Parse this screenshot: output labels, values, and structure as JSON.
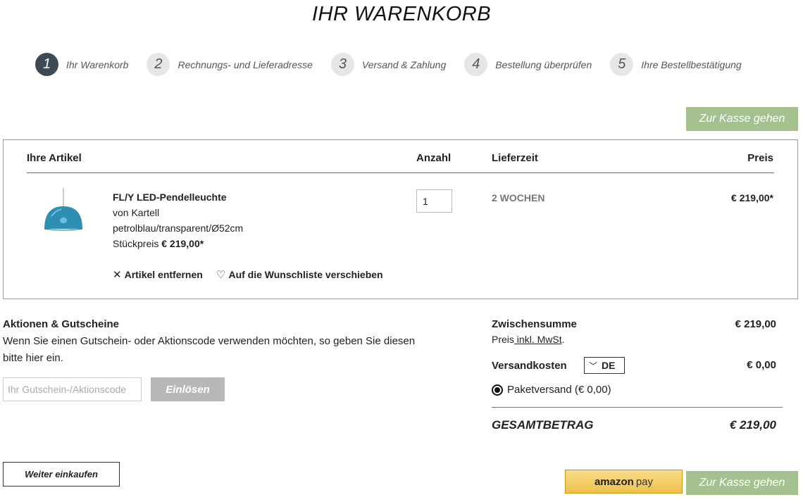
{
  "page": {
    "title": "IHR WARENKORB"
  },
  "steps": [
    {
      "num": "1",
      "label": "Ihr Warenkorb"
    },
    {
      "num": "2",
      "label": "Rechnungs- und Lieferadresse"
    },
    {
      "num": "3",
      "label": "Versand & Zahlung"
    },
    {
      "num": "4",
      "label": "Bestellung überprüfen"
    },
    {
      "num": "5",
      "label": "Ihre Bestellbestätigung"
    }
  ],
  "checkout_label": "Zur Kasse gehen",
  "cart": {
    "headers": {
      "items": "Ihre Artikel",
      "qty": "Anzahl",
      "delivery": "Lieferzeit",
      "price": "Preis"
    },
    "item": {
      "name": "FL/Y LED-Pendelleuchte",
      "brand": "von Kartell",
      "variant": "petrolblau/transparent/Ø52cm",
      "unit_price_label": "Stückpreis",
      "unit_price": "€ 219,00*",
      "qty": "1",
      "delivery": "2 WOCHEN",
      "price": "€ 219,00*",
      "remove_label": "Artikel entfernen",
      "wishlist_label": "Auf die Wunschliste verschieben"
    }
  },
  "promo": {
    "title": "Aktionen & Gutscheine",
    "text": "Wenn Sie einen Gutschein- oder Aktionscode verwenden möchten, so geben Sie diesen bitte hier ein.",
    "placeholder": "Ihr Gutschein-/Aktionscode",
    "button": "Einlösen"
  },
  "summary": {
    "subtotal_label": "Zwischensumme",
    "subtotal": "€ 219,00",
    "vat_prefix": "Preis",
    "vat_link": " inkl. MwSt",
    "vat_suffix": ".",
    "shipping_label": "Versandkosten",
    "country": "DE",
    "shipping": "€ 0,00",
    "shipping_option": "Paketversand (€ 0,00)",
    "total_label": "GESAMTBETRAG",
    "total": "€ 219,00"
  },
  "footer": {
    "continue_label": "Weiter einkaufen",
    "amazon_brand": "amazon",
    "amazon_pay": "pay"
  },
  "colors": {
    "accent_green": "#a5c18f",
    "active_step": "#3d4a56",
    "lamp_blue": "#2e8fb3"
  }
}
